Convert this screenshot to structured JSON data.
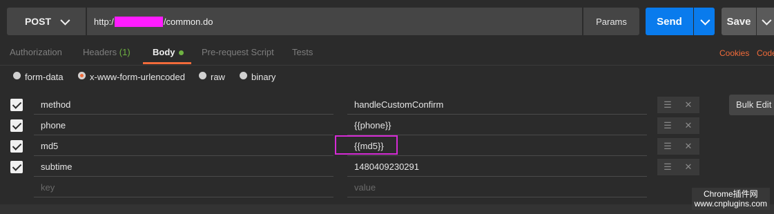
{
  "request": {
    "method": "POST",
    "url_prefix": "http:/",
    "url_suffix": "/common.do",
    "params_label": "Params",
    "send_label": "Send",
    "save_label": "Save"
  },
  "tabs": [
    {
      "label": "Authorization"
    },
    {
      "label": "Headers",
      "count": "(1)"
    },
    {
      "label": "Body"
    },
    {
      "label": "Pre-request Script"
    },
    {
      "label": "Tests"
    }
  ],
  "tab_links": {
    "cookies": "Cookies",
    "code": "Code"
  },
  "body_modes": [
    {
      "label": "form-data",
      "selected": false
    },
    {
      "label": "x-www-form-urlencoded",
      "selected": true
    },
    {
      "label": "raw",
      "selected": false
    },
    {
      "label": "binary",
      "selected": false
    }
  ],
  "params": [
    {
      "key": "method",
      "value": "handleCustomConfirm"
    },
    {
      "key": "phone",
      "value": "{{phone}}"
    },
    {
      "key": "md5",
      "value": "{{md5}}"
    },
    {
      "key": "subtime",
      "value": "1480409230291"
    }
  ],
  "new_row": {
    "key_placeholder": "key",
    "value_placeholder": "value"
  },
  "row_actions": {
    "menu": "☰",
    "delete": "✕"
  },
  "bulk_edit_label": "Bulk Edit",
  "watermark": {
    "line1": "Chrome插件网",
    "line2": "www.cnplugins.com"
  },
  "colors": {
    "accent": "#f26b3a",
    "send": "#097bed",
    "active_dot": "#6fb342",
    "highlight": "#d62bd6"
  }
}
